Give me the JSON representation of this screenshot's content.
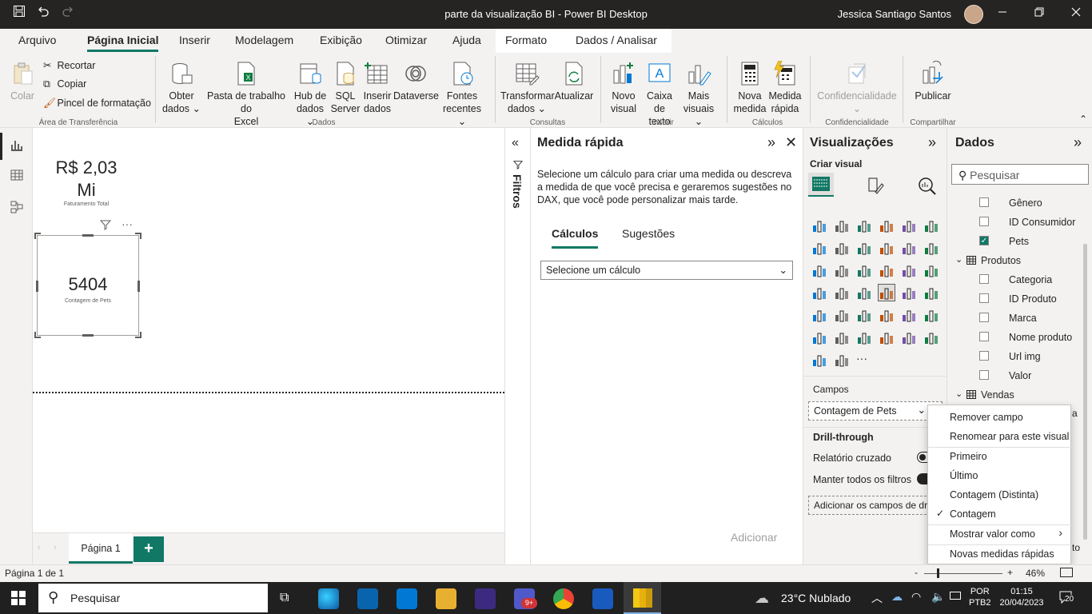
{
  "window": {
    "title": "parte da visualização BI - Power BI Desktop",
    "user": "Jessica Santiago Santos"
  },
  "menu": {
    "tabs": [
      "Arquivo",
      "Página Inicial",
      "Inserir",
      "Modelagem",
      "Exibição",
      "Otimizar",
      "Ajuda",
      "Formato",
      "Dados / Analisar"
    ]
  },
  "ribbon": {
    "clipboard": {
      "paste": "Colar",
      "cut": "Recortar",
      "copy": "Copiar",
      "format_painter": "Pincel de formatação",
      "group": "Área de Transferência"
    },
    "data": {
      "get_data_1": "Obter",
      "get_data_2": "dados",
      "excel_1": "Pasta de trabalho do",
      "excel_2": "Excel",
      "hub_1": "Hub de",
      "hub_2": "dados",
      "sql_1": "SQL",
      "sql_2": "Server",
      "enter_1": "Inserir",
      "enter_2": "dados",
      "dataverse": "Dataverse",
      "recent_1": "Fontes",
      "recent_2": "recentes",
      "group": "Dados"
    },
    "queries": {
      "transform_1": "Transformar",
      "transform_2": "dados",
      "refresh": "Atualizar",
      "group": "Consultas"
    },
    "insert": {
      "new_visual_1": "Novo",
      "new_visual_2": "visual",
      "textbox_1": "Caixa de",
      "textbox_2": "texto",
      "more_1": "Mais",
      "more_2": "visuais",
      "group": "Inserir"
    },
    "calc": {
      "new_measure_1": "Nova",
      "new_measure_2": "medida",
      "quick_1": "Medida",
      "quick_2": "rápida",
      "group": "Cálculos"
    },
    "sensitivity": {
      "label": "Confidencialidade",
      "group": "Confidencialidade"
    },
    "share": {
      "publish": "Publicar",
      "group": "Compartilhar"
    }
  },
  "canvas": {
    "card1": {
      "value_1": "R$ 2,03",
      "value_2": "Mi",
      "caption": "Faturamento Total"
    },
    "card2": {
      "value": "5404",
      "caption": "Contagem de Pets"
    }
  },
  "pages": {
    "tab": "Página 1",
    "add": "+"
  },
  "filters": {
    "label": "Filtros"
  },
  "quick_measure": {
    "title": "Medida rápida",
    "description": "Selecione um cálculo para criar uma medida ou descreva a medida de que você precisa e geraremos sugestões no DAX, que você pode personalizar mais tarde.",
    "tab_calc": "Cálculos",
    "tab_sugg": "Sugestões",
    "select_placeholder": "Selecione um cálculo",
    "add_button": "Adicionar"
  },
  "visualizations": {
    "title": "Visualizações",
    "create": "Criar visual",
    "fields_label": "Campos",
    "field_value": "Contagem de Pets",
    "drillthrough": "Drill-through",
    "cross_report": "Relatório cruzado",
    "keep_filters": "Manter todos os filtros",
    "add_drill": "Adicionar os campos de dr"
  },
  "data_pane": {
    "title": "Dados",
    "search_placeholder": "Pesquisar",
    "items": [
      {
        "label": "Gênero",
        "checked": false
      },
      {
        "label": "ID Consumidor",
        "checked": false
      },
      {
        "label": "Pets",
        "checked": true
      }
    ],
    "table_produtos": "Produtos",
    "produtos_fields": [
      "Categoria",
      "ID Produto",
      "Marca",
      "Nome produto",
      "Url img",
      "Valor"
    ],
    "table_vendas": "Vendas",
    "trail_a": "a",
    "trail_to": "to"
  },
  "context_menu": {
    "items": [
      "Remover campo",
      "Renomear para este visual",
      "Primeiro",
      "Último",
      "Contagem (Distinta)",
      "Contagem",
      "Mostrar valor como",
      "Novas medidas rápidas"
    ],
    "checked": "Contagem"
  },
  "status": {
    "page": "Página 1 de 1",
    "zoom": "46%",
    "zoom_minus": "-",
    "zoom_plus": "+"
  },
  "taskbar": {
    "search": "Pesquisar",
    "weather": "23°C  Nublado",
    "lang_1": "POR",
    "lang_2": "PTB2",
    "time": "01:15",
    "date": "20/04/2023",
    "notif": "20",
    "teams_badge": "9+"
  }
}
